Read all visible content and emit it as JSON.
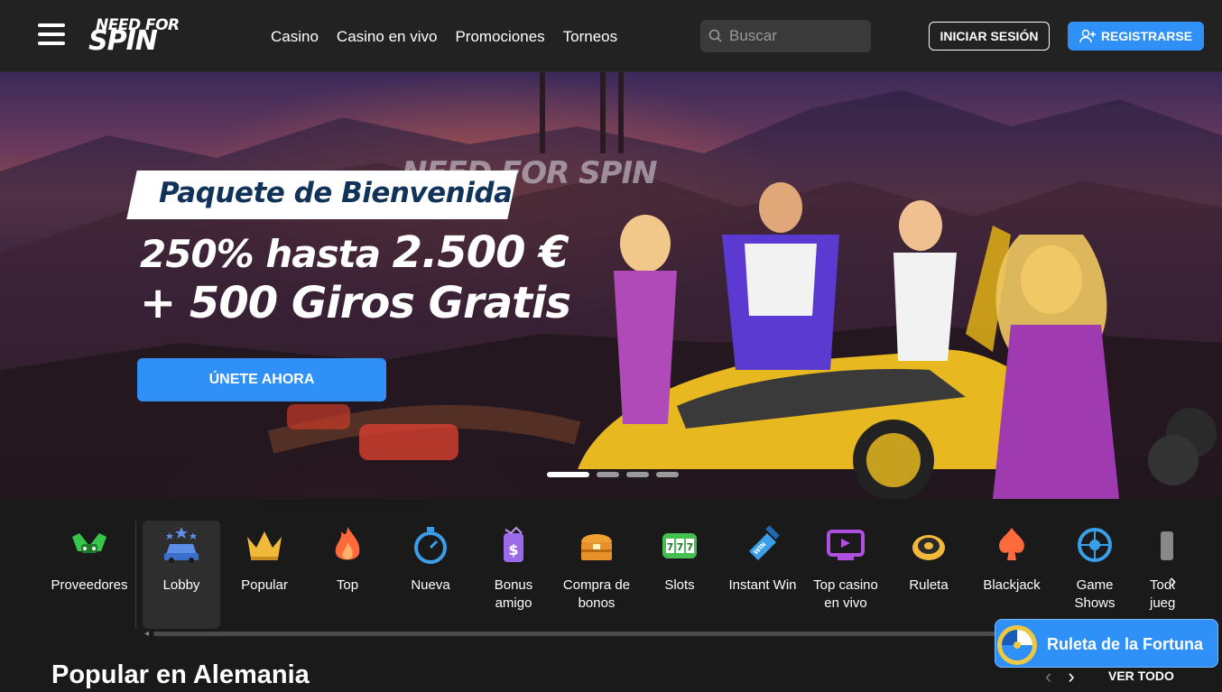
{
  "header": {
    "logo_line1": "NEED FOR",
    "logo_line2": "SPIN",
    "nav": [
      "Casino",
      "Casino en vivo",
      "Promociones",
      "Torneos"
    ],
    "search_placeholder": "Buscar",
    "login_label": "INICIAR SESIÓN",
    "register_label": "REGISTRARSE"
  },
  "hero": {
    "sign_text": "NEED FOR SPIN",
    "tag": "Paquete de Bienvenida",
    "line1_prefix": "250% hasta ",
    "line1_amount": "2.500 €",
    "line2": "+ 500 Giros Gratis",
    "cta": "ÚNETE AHORA",
    "slides": 4,
    "active_slide": 1
  },
  "categories": [
    {
      "label": "Proveedores",
      "icon": "providers-icon",
      "color": "#37c64a"
    },
    {
      "label": "Lobby",
      "icon": "lobby-car-icon",
      "color": "#5b8ee6",
      "active": true
    },
    {
      "label": "Popular",
      "icon": "crown-icon",
      "color": "#f0b93a"
    },
    {
      "label": "Top",
      "icon": "flame-icon",
      "color": "#ff6a3d"
    },
    {
      "label": "Nueva",
      "icon": "stopwatch-icon",
      "color": "#3a9ee8"
    },
    {
      "label": "Bonus amigo",
      "icon": "bonus-friend-icon",
      "color": "#9a6ae8"
    },
    {
      "label": "Compra de bonos",
      "icon": "chest-icon",
      "color": "#f0a030"
    },
    {
      "label": "Slots",
      "icon": "slots-777-icon",
      "color": "#45c050"
    },
    {
      "label": "Instant Win",
      "icon": "instant-win-icon",
      "color": "#3a9ee8"
    },
    {
      "label": "Top casino en vivo",
      "icon": "live-casino-icon",
      "color": "#b050e0"
    },
    {
      "label": "Ruleta",
      "icon": "roulette-icon",
      "color": "#f0b93a"
    },
    {
      "label": "Blackjack",
      "icon": "blackjack-icon",
      "color": "#ff6a3d"
    },
    {
      "label": "Game Shows",
      "icon": "game-shows-icon",
      "color": "#3a9ee8"
    },
    {
      "label": "Todos los juegos",
      "icon": "all-games-icon",
      "color": "#888888"
    }
  ],
  "section": {
    "title": "Popular en Alemania",
    "view_all": "VER TODO"
  },
  "fortune": {
    "label": "Ruleta de la Fortuna"
  }
}
